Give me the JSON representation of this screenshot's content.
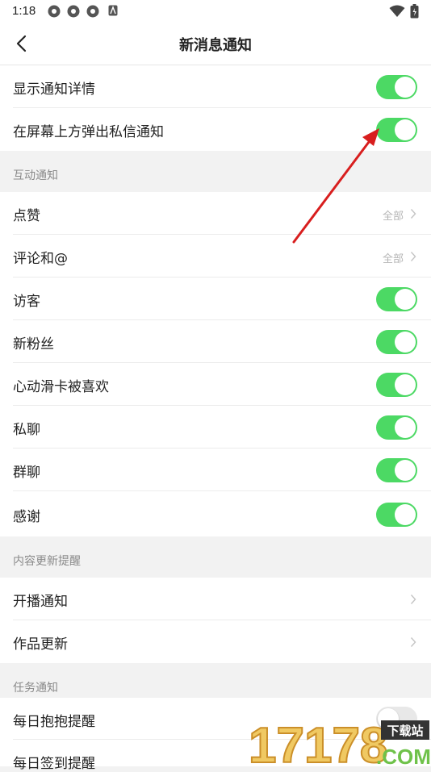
{
  "status_bar": {
    "time": "1:18"
  },
  "header": {
    "title": "新消息通知"
  },
  "top_settings": [
    {
      "label": "显示通知详情",
      "enabled": true
    },
    {
      "label": "在屏幕上方弹出私信通知",
      "enabled": true
    }
  ],
  "sections": [
    {
      "title": "互动通知",
      "items": [
        {
          "label": "点赞",
          "value": "全部"
        },
        {
          "label": "评论和@",
          "value": "全部"
        },
        {
          "label": "访客",
          "enabled": true
        },
        {
          "label": "新粉丝",
          "enabled": true
        },
        {
          "label": "心动滑卡被喜欢",
          "enabled": true
        },
        {
          "label": "私聊",
          "enabled": true
        },
        {
          "label": "群聊",
          "enabled": true
        },
        {
          "label": "感谢",
          "enabled": true
        }
      ]
    },
    {
      "title": "内容更新提醒",
      "items": [
        {
          "label": "开播通知"
        },
        {
          "label": "作品更新"
        }
      ]
    },
    {
      "title": "任务通知",
      "items": [
        {
          "label": "每日抱抱提醒",
          "enabled": false
        },
        {
          "label": "每日签到提醒"
        }
      ]
    }
  ],
  "watermark": {
    "number": "17178",
    "badge": "下载站",
    "suffix": ".COM"
  },
  "colors": {
    "toggle_on": "#4cd964",
    "toggle_off": "#e8e8e8",
    "annotation_arrow": "#d81e1e"
  }
}
